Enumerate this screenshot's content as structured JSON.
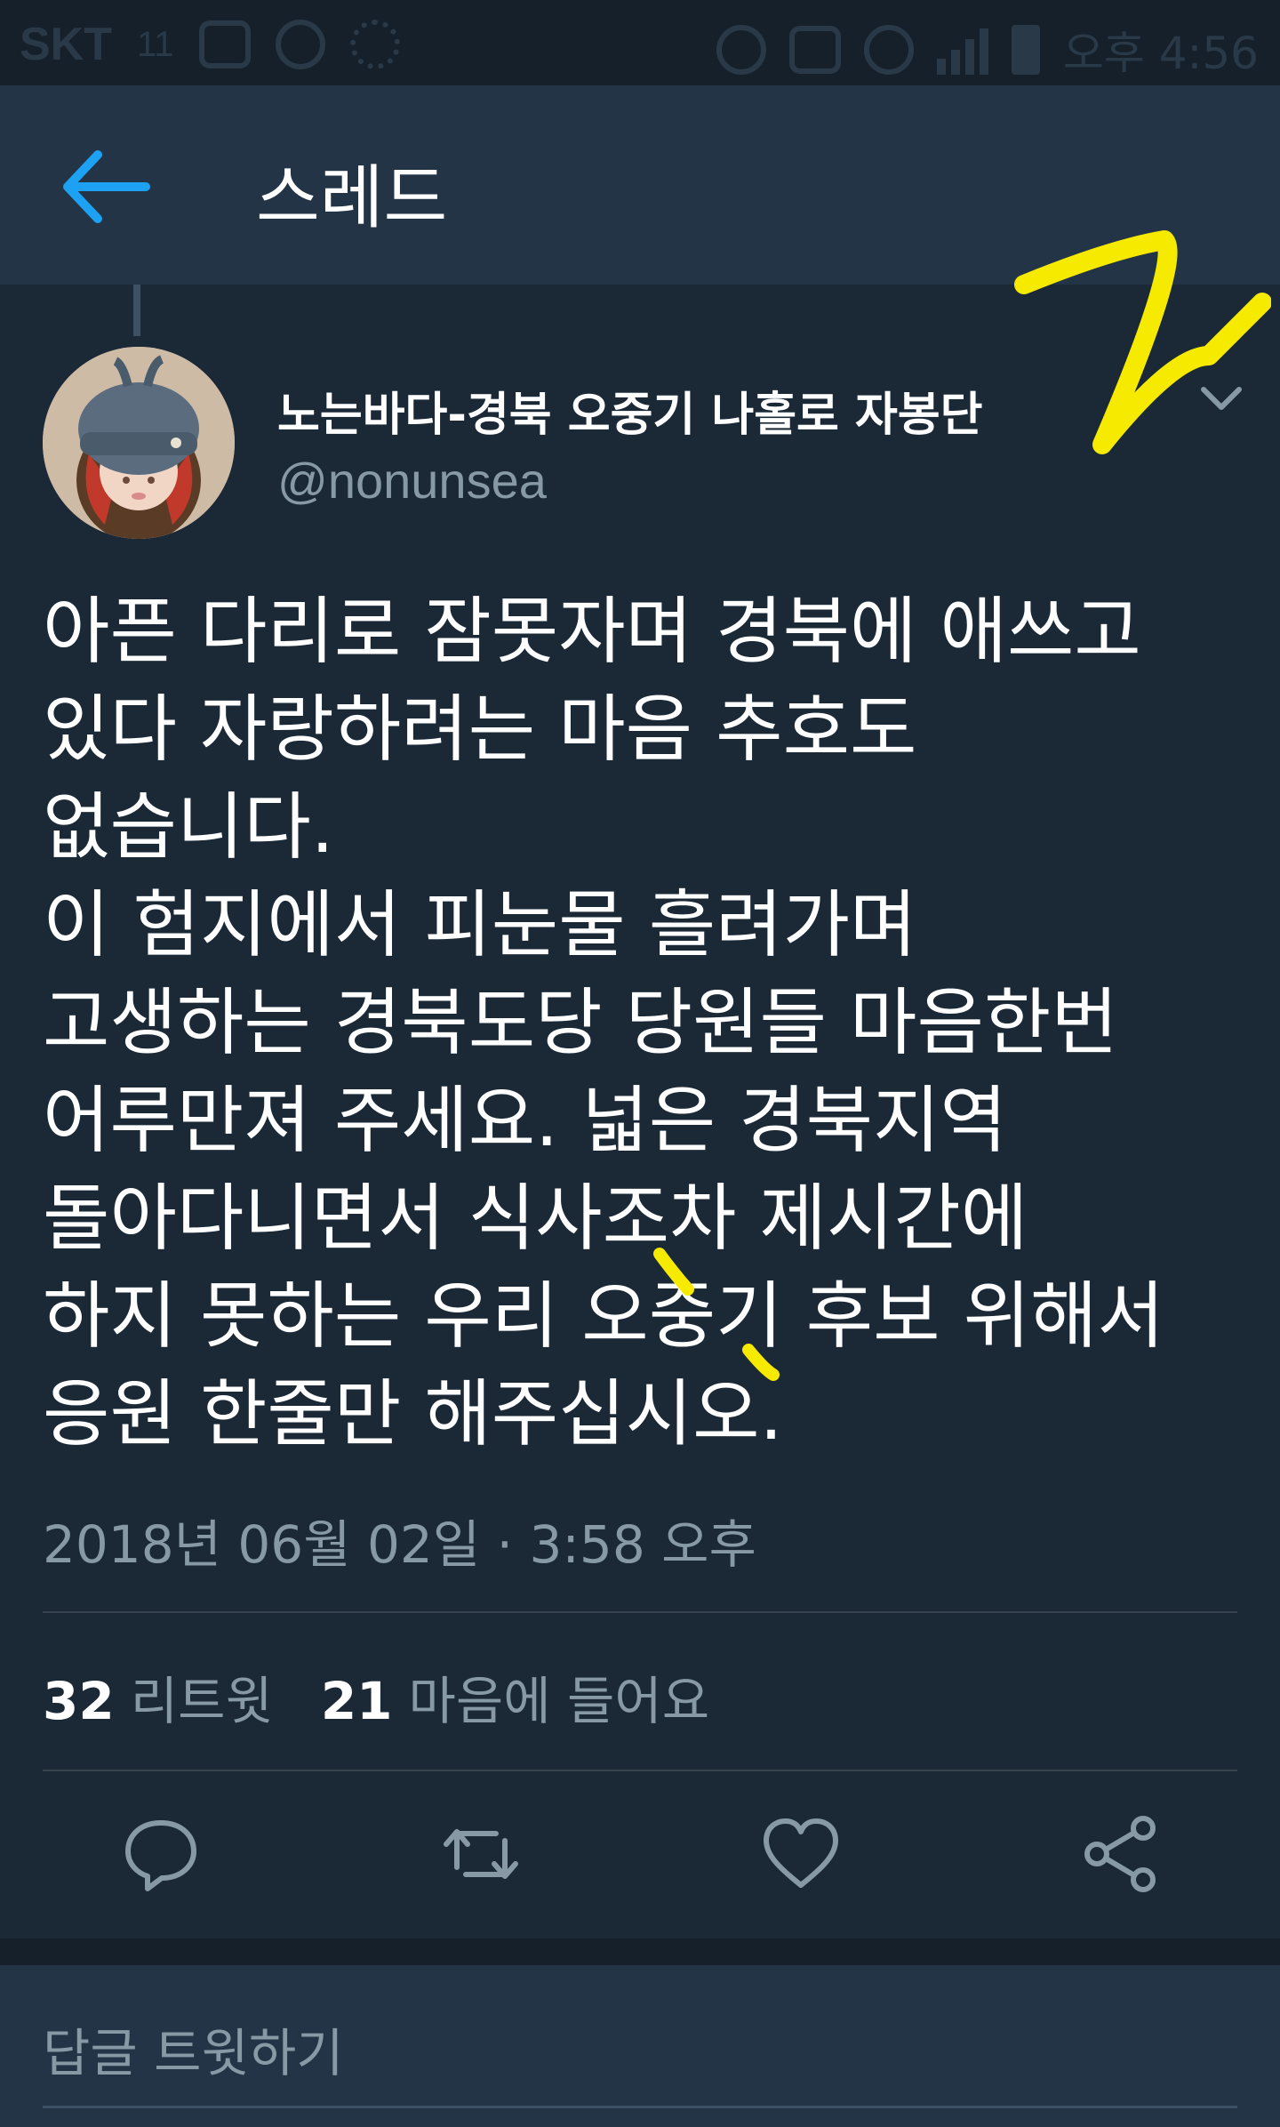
{
  "status_bar": {
    "carrier": "SKT",
    "network": "11",
    "time": "오후 4:56"
  },
  "header": {
    "title": "스레드",
    "back_icon": "arrow-left-icon"
  },
  "tweet": {
    "display_name": "노는바다-경북 오중기 나홀로 자봉단",
    "handle": "@nonunsea",
    "text_lines": [
      "아픈 다리로 잠못자며 경북에 애쓰고",
      "있다 자랑하려는 마음 추호도",
      "없습니다.",
      "이 험지에서 피눈물 흘려가며",
      "고생하는 경북도당 당원들 마음한번",
      "어루만져 주세요. 넓은 경북지역",
      "돌아다니면서 식사조차 제시간에",
      "하지 못하는 우리 오중기 후보 위해서",
      "응원 한줄만 해주십시오."
    ],
    "timestamp": "2018년 06월 02일 · 3:58 오후",
    "retweet_count": "32",
    "retweet_label": "리트윗",
    "like_count": "21",
    "like_label": "마음에 들어요"
  },
  "actions": {
    "reply_icon": "reply-icon",
    "retweet_icon": "retweet-icon",
    "like_icon": "heart-icon",
    "share_icon": "share-icon"
  },
  "reply_box": {
    "placeholder": "답글 트윗하기"
  },
  "colors": {
    "background": "#1b2836",
    "header": "#243447",
    "accent": "#1da1f2",
    "secondary_text": "#8899a6",
    "annotation": "#f5ea00"
  }
}
